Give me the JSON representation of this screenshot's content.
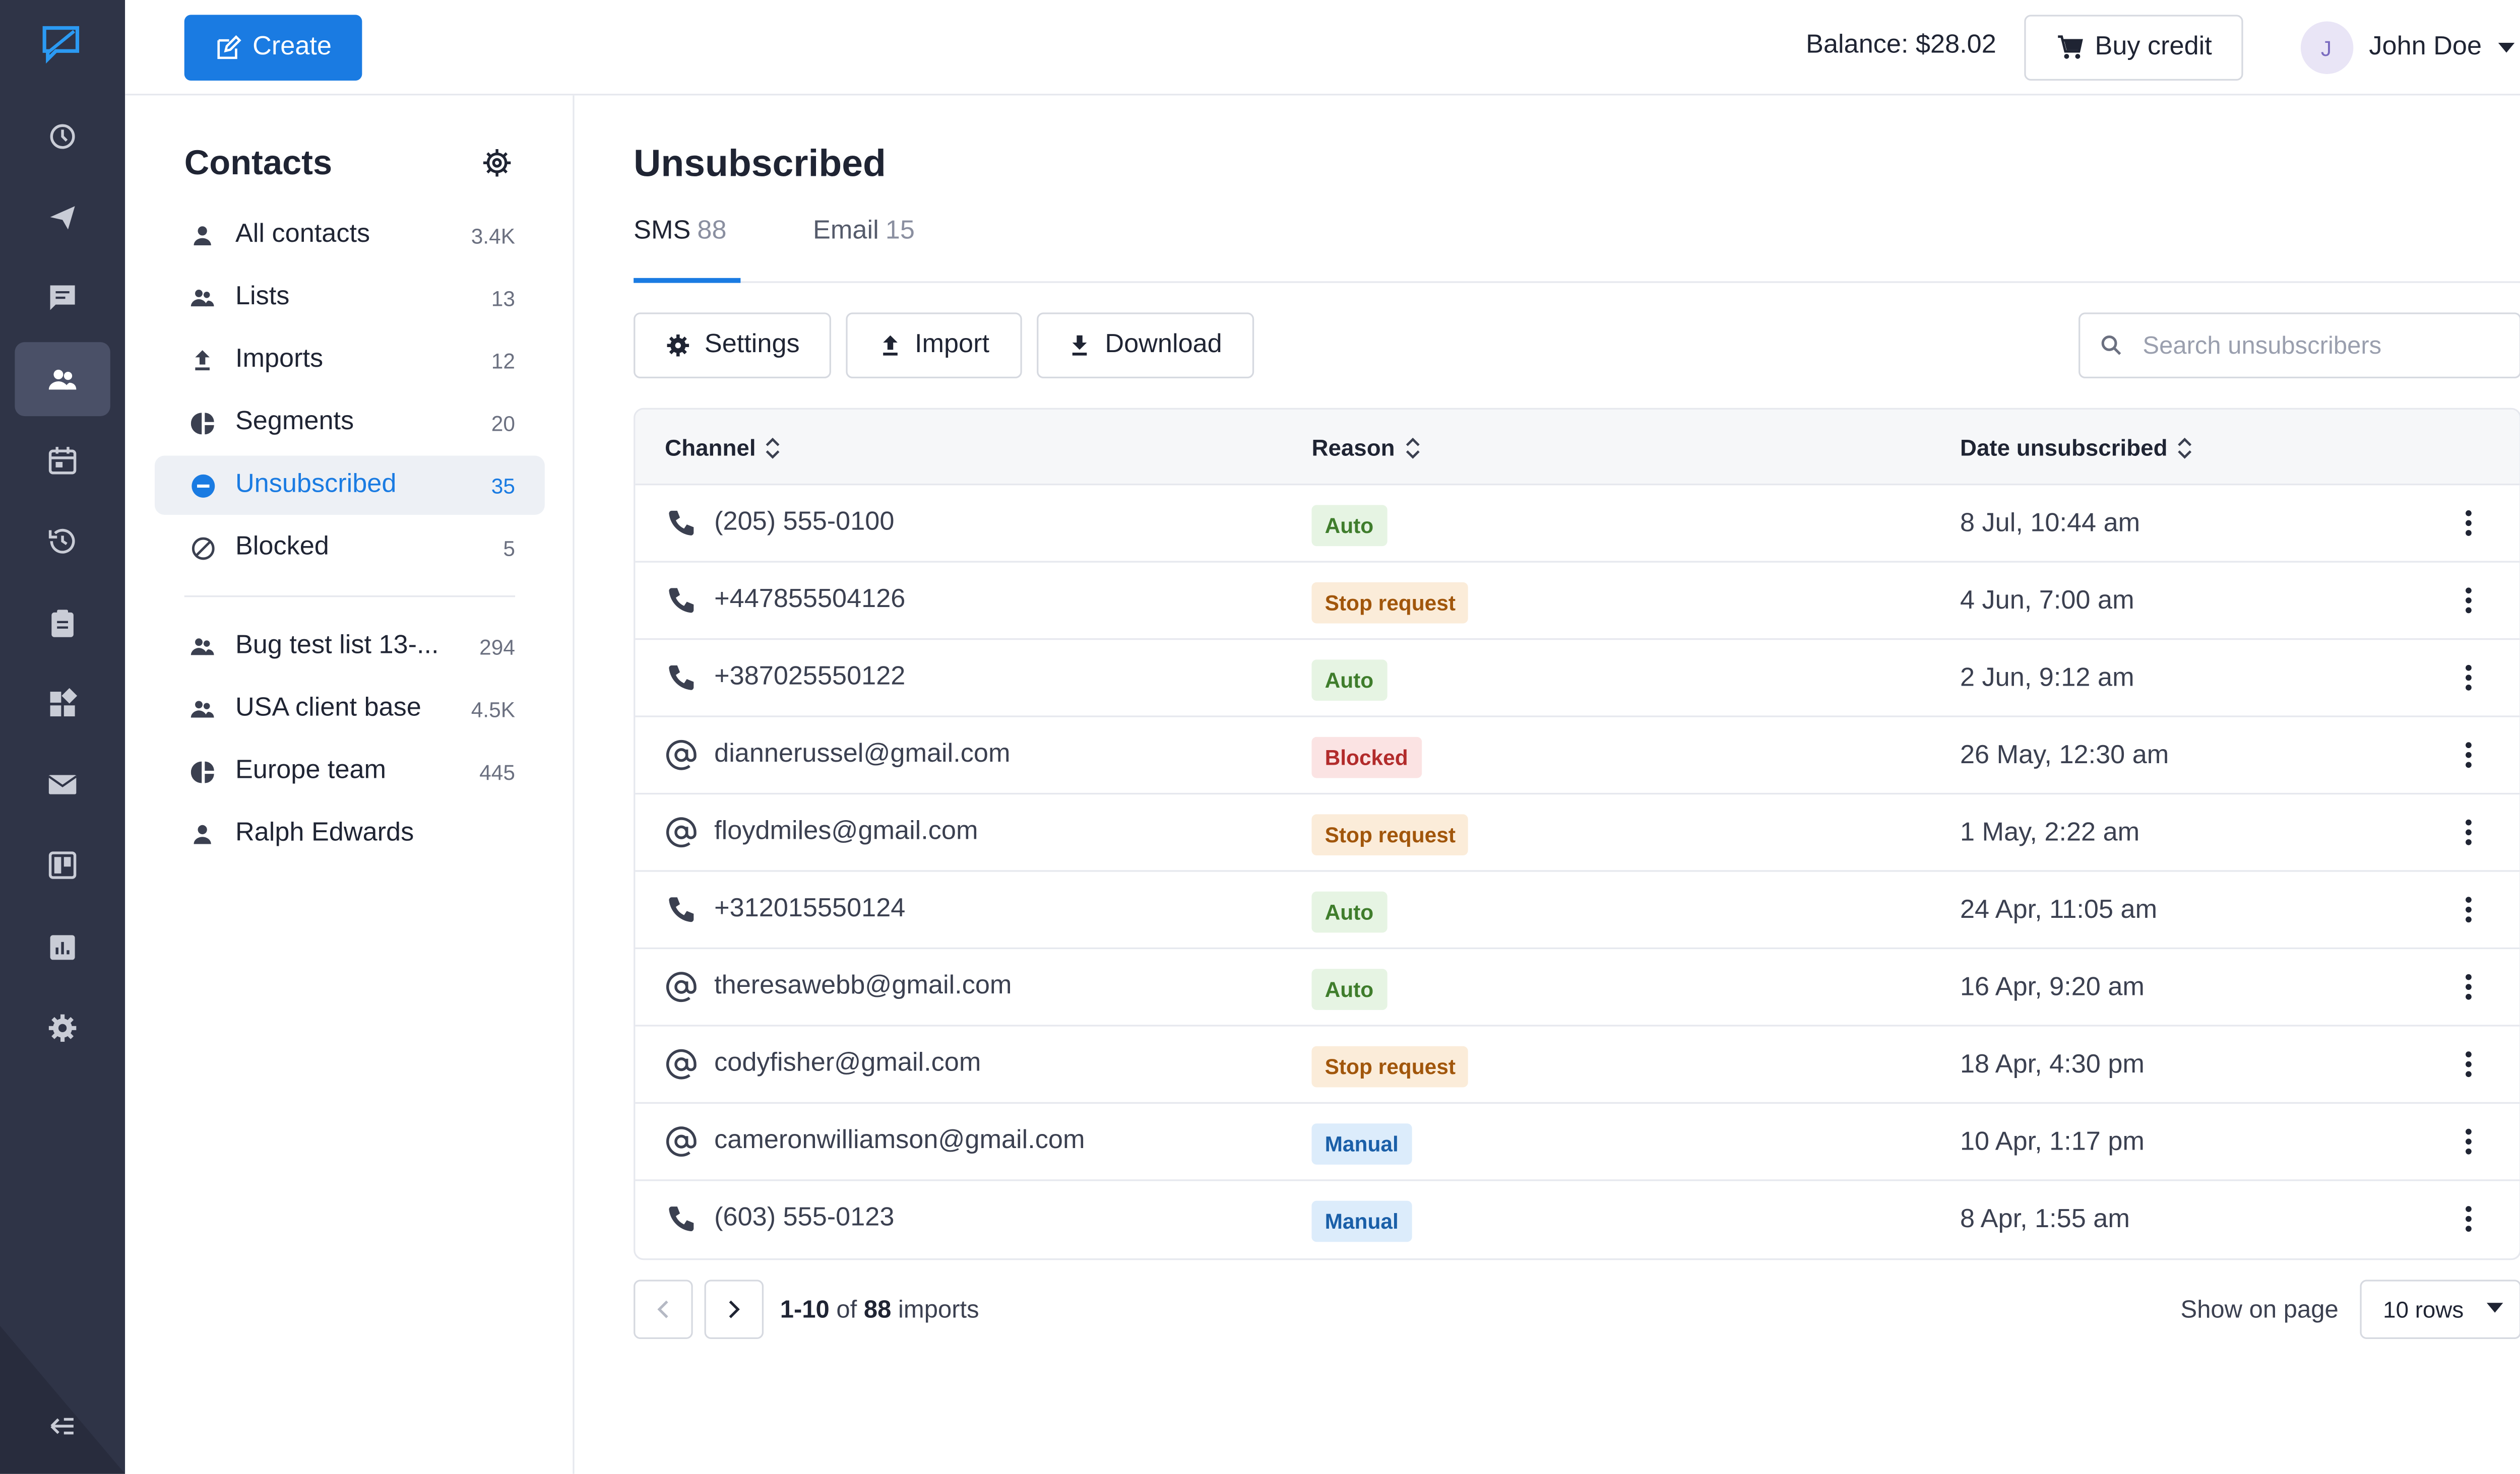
{
  "topbar": {
    "create_label": "Create",
    "balance": "Balance: $28.02",
    "buy_credit_label": "Buy credit",
    "user_initial": "J",
    "user_name": "John Doe"
  },
  "rail": {
    "items": [
      "history-icon",
      "send-icon",
      "chat-icon",
      "contacts-icon",
      "calendar-icon",
      "restore-icon",
      "clipboard-icon",
      "apps-icon",
      "mail-icon",
      "board-icon",
      "analytics-icon",
      "settings-icon"
    ],
    "collapse_icon": "collapse-icon"
  },
  "sidebar": {
    "title": "Contacts",
    "items": [
      {
        "label": "All contacts",
        "count": "3.4K",
        "icon": "person-icon"
      },
      {
        "label": "Lists",
        "count": "13",
        "icon": "people-icon"
      },
      {
        "label": "Imports",
        "count": "12",
        "icon": "upload-icon"
      },
      {
        "label": "Segments",
        "count": "20",
        "icon": "pie-icon"
      },
      {
        "label": "Unsubscribed",
        "count": "35",
        "icon": "minus-circle-icon"
      },
      {
        "label": "Blocked",
        "count": "5",
        "icon": "block-icon"
      }
    ],
    "lists": [
      {
        "label": "Bug test list 13-...",
        "count": "294",
        "icon": "people-icon"
      },
      {
        "label": "USA client base",
        "count": "4.5K",
        "icon": "people-icon"
      },
      {
        "label": "Europe team",
        "count": "445",
        "icon": "pie-icon"
      },
      {
        "label": "Ralph Edwards",
        "count": "",
        "icon": "person-icon"
      }
    ]
  },
  "main": {
    "title": "Unsubscribed",
    "tabs": [
      {
        "label": "SMS",
        "count": "88"
      },
      {
        "label": "Email",
        "count": "15"
      }
    ],
    "toolbar": {
      "settings_label": "Settings",
      "import_label": "Import",
      "download_label": "Download",
      "search_placeholder": "Search unsubscribers"
    },
    "table": {
      "headers": [
        "Channel",
        "Reason",
        "Date unsubscribed"
      ],
      "rows": [
        {
          "type": "phone",
          "channel": "(205) 555-0100",
          "reason": "Auto",
          "date": "8 Jul, 10:44 am"
        },
        {
          "type": "phone",
          "channel": "+447855504126",
          "reason": "Stop request",
          "date": "4 Jun, 7:00 am"
        },
        {
          "type": "phone",
          "channel": "+387025550122",
          "reason": "Auto",
          "date": "2 Jun, 9:12 am"
        },
        {
          "type": "email",
          "channel": "diannerussel@gmail.com",
          "reason": "Blocked",
          "date": "26 May, 12:30 am"
        },
        {
          "type": "email",
          "channel": "floydmiles@gmail.com",
          "reason": "Stop request",
          "date": "1 May, 2:22 am"
        },
        {
          "type": "phone",
          "channel": "+312015550124",
          "reason": "Auto",
          "date": "24 Apr, 11:05 am"
        },
        {
          "type": "email",
          "channel": "theresawebb@gmail.com",
          "reason": "Auto",
          "date": "16 Apr, 9:20 am"
        },
        {
          "type": "email",
          "channel": "codyfisher@gmail.com",
          "reason": "Stop request",
          "date": "18 Apr, 4:30 pm"
        },
        {
          "type": "email",
          "channel": "cameronwilliamson@gmail.com",
          "reason": "Manual",
          "date": "10 Apr, 1:17 pm"
        },
        {
          "type": "phone",
          "channel": "(603) 555-0123",
          "reason": "Manual",
          "date": "8 Apr, 1:55 am"
        }
      ]
    },
    "pager": {
      "range": "1-10",
      "of": "of",
      "total": "88",
      "unit": "imports",
      "show_label": "Show on page",
      "rows_value": "10 rows"
    }
  },
  "colors": {
    "accent": "#1a7be2",
    "rail_bg": "#2f3447",
    "badge_auto": "#e6f4e3",
    "badge_stop": "#fbecd9",
    "badge_blocked": "#fbe3e3",
    "badge_manual": "#dcecfb"
  }
}
